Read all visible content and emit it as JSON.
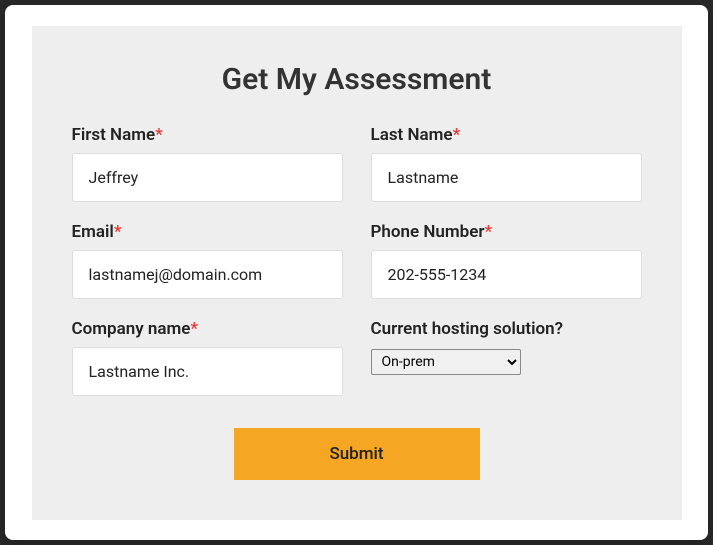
{
  "title": "Get My Assessment",
  "fields": {
    "first_name": {
      "label": "First Name",
      "required": true,
      "value": "Jeffrey"
    },
    "last_name": {
      "label": "Last Name",
      "required": true,
      "value": "Lastname"
    },
    "email": {
      "label": "Email",
      "required": true,
      "value": "lastnamej@domain.com"
    },
    "phone": {
      "label": "Phone Number",
      "required": true,
      "value": "202-555-1234"
    },
    "company": {
      "label": "Company name",
      "required": true,
      "value": "Lastname Inc."
    },
    "hosting": {
      "label": "Current hosting solution?",
      "required": false,
      "selected": "On-prem",
      "options": [
        "On-prem"
      ]
    }
  },
  "required_mark": "*",
  "submit_label": "Submit"
}
